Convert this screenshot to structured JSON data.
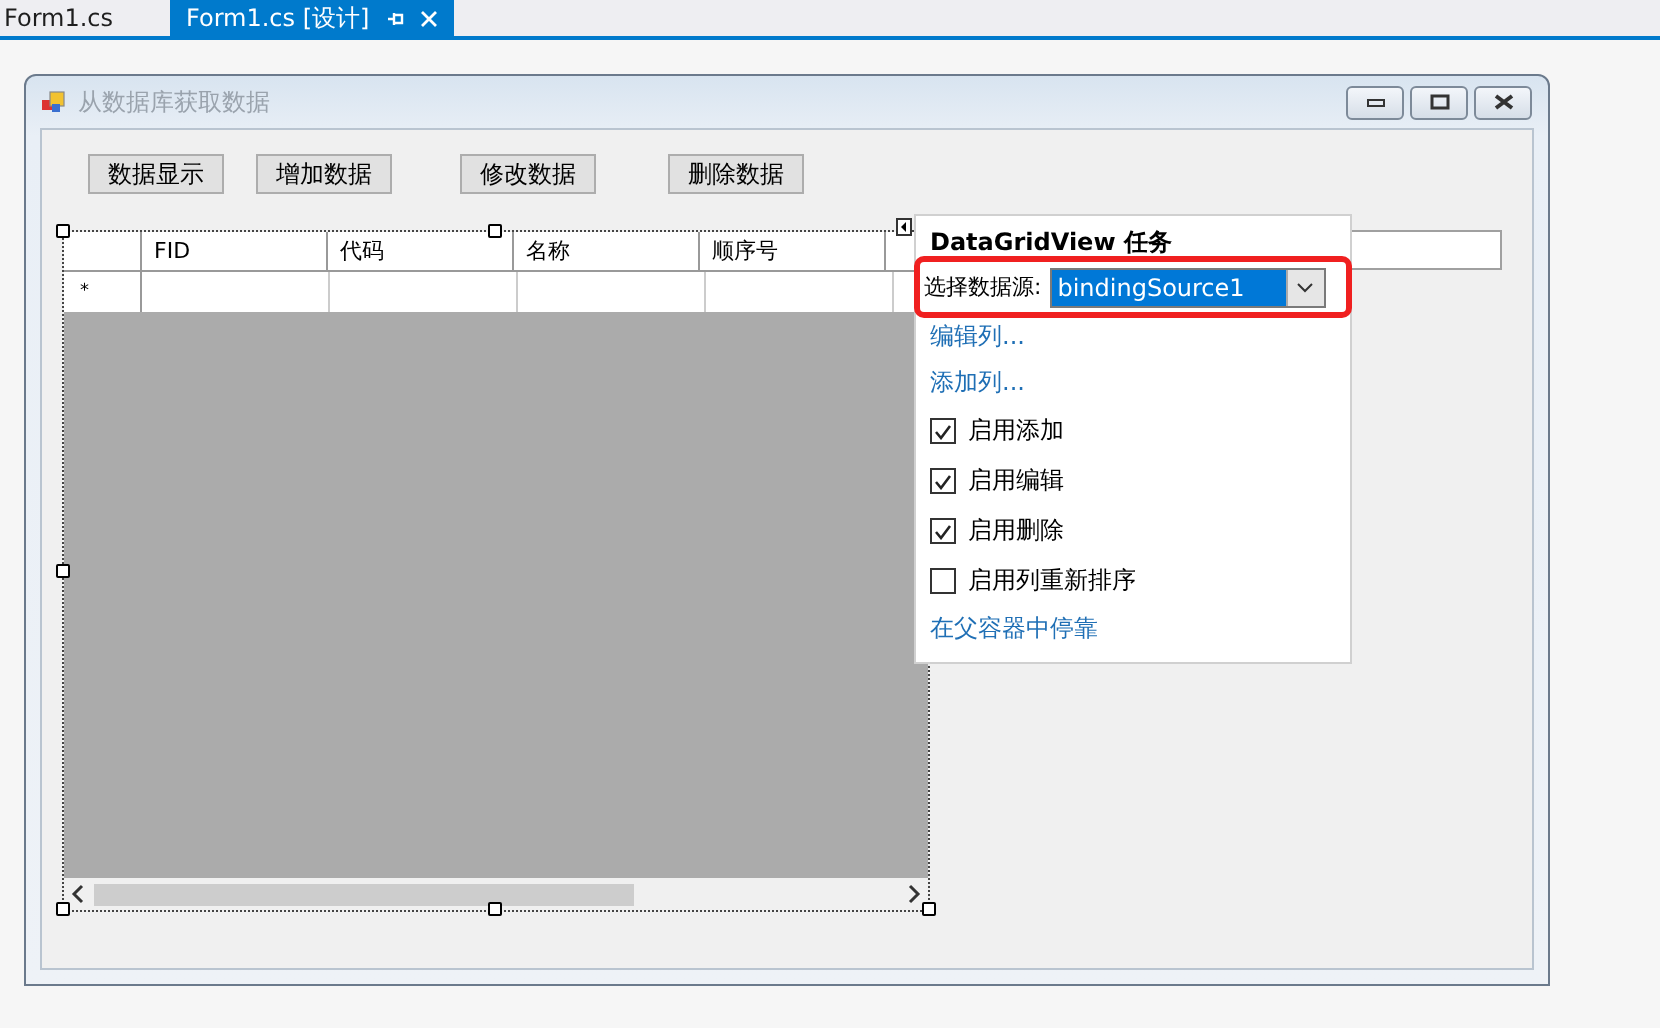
{
  "tabs": [
    {
      "label": "Form1.cs",
      "selected": false
    },
    {
      "label": "Form1.cs [设计]",
      "selected": true
    }
  ],
  "form": {
    "title": "从数据库获取数据",
    "buttons": [
      "数据显示",
      "增加数据",
      "修改数据",
      "删除数据"
    ],
    "grid": {
      "columns": [
        "FID",
        "代码",
        "名称",
        "顺序号"
      ],
      "new_row_marker": "*"
    }
  },
  "tasks_panel": {
    "title": "DataGridView 任务",
    "data_source": {
      "label": "选择数据源:",
      "value": "bindingSource1",
      "highlighted": true
    },
    "items": [
      {
        "kind": "link",
        "label": "编辑列..."
      },
      {
        "kind": "link",
        "label": "添加列..."
      },
      {
        "kind": "checkbox",
        "label": "启用添加",
        "checked": true
      },
      {
        "kind": "checkbox",
        "label": "启用编辑",
        "checked": true
      },
      {
        "kind": "checkbox",
        "label": "启用删除",
        "checked": true
      },
      {
        "kind": "checkbox",
        "label": "启用列重新排序",
        "checked": false
      },
      {
        "kind": "link",
        "label": "在父容器中停靠"
      }
    ]
  }
}
